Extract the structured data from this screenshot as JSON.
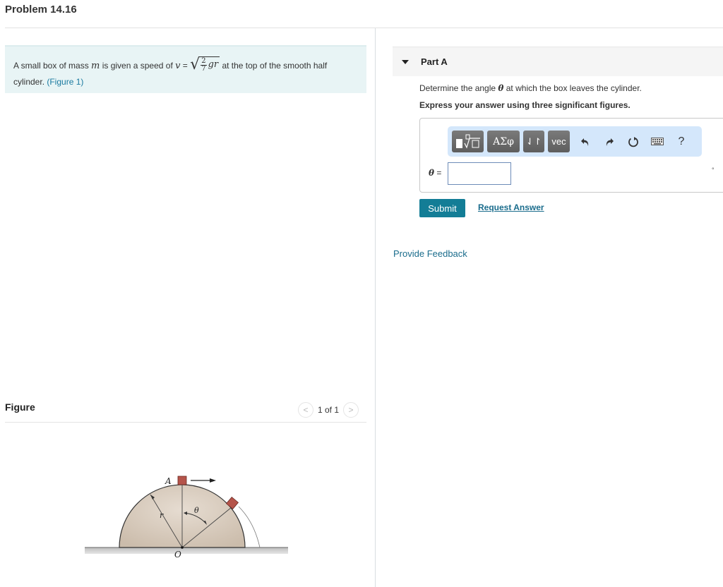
{
  "header": {
    "title": "Problem 14.16"
  },
  "intro": {
    "text_before": "A small box of mass ",
    "mass_symbol": "m",
    "text_mid": " is given a speed of ",
    "v_symbol": "v",
    "equals": " = ",
    "frac_num": "2",
    "frac_den": "7",
    "g_r": "gr",
    "text_after": " at the top of the smooth half",
    "text_line2": "cylinder. ",
    "figure_link": "(Figure 1)"
  },
  "figure": {
    "label": "Figure",
    "pager": "1 of 1",
    "prev_icon": "chevron-left-icon",
    "next_icon": "chevron-right-icon",
    "labels": {
      "A": "A",
      "r": "r",
      "theta": "θ",
      "O": "O"
    },
    "colors": {
      "cylinder": "#d8cbbd",
      "box": "#b5544a",
      "ground": "#c9c9c9"
    }
  },
  "part": {
    "title": "Part A",
    "question_before": "Determine the angle ",
    "question_symbol": "θ",
    "question_after": " at which the box leaves the cylinder.",
    "instruction": "Express your answer using three significant figures."
  },
  "toolbar": {
    "templates_label": "√□",
    "greek_label": "ΑΣφ",
    "arrows_label": "⇃↾",
    "vec_label": "vec",
    "undo_icon": "undo-icon",
    "redo_icon": "redo-icon",
    "reset_icon": "reset-icon",
    "keyboard_icon": "keyboard-icon",
    "help_label": "?"
  },
  "answer": {
    "variable": "θ",
    "equals": " =",
    "value": "",
    "unit": "°"
  },
  "actions": {
    "submit": "Submit",
    "request_answer": "Request Answer",
    "feedback": "Provide Feedback"
  },
  "colors": {
    "accent": "#137d96",
    "link": "#1a6c8c",
    "intro_bg": "#e8f4f5",
    "toolbar_bg": "#d4e7fb"
  }
}
